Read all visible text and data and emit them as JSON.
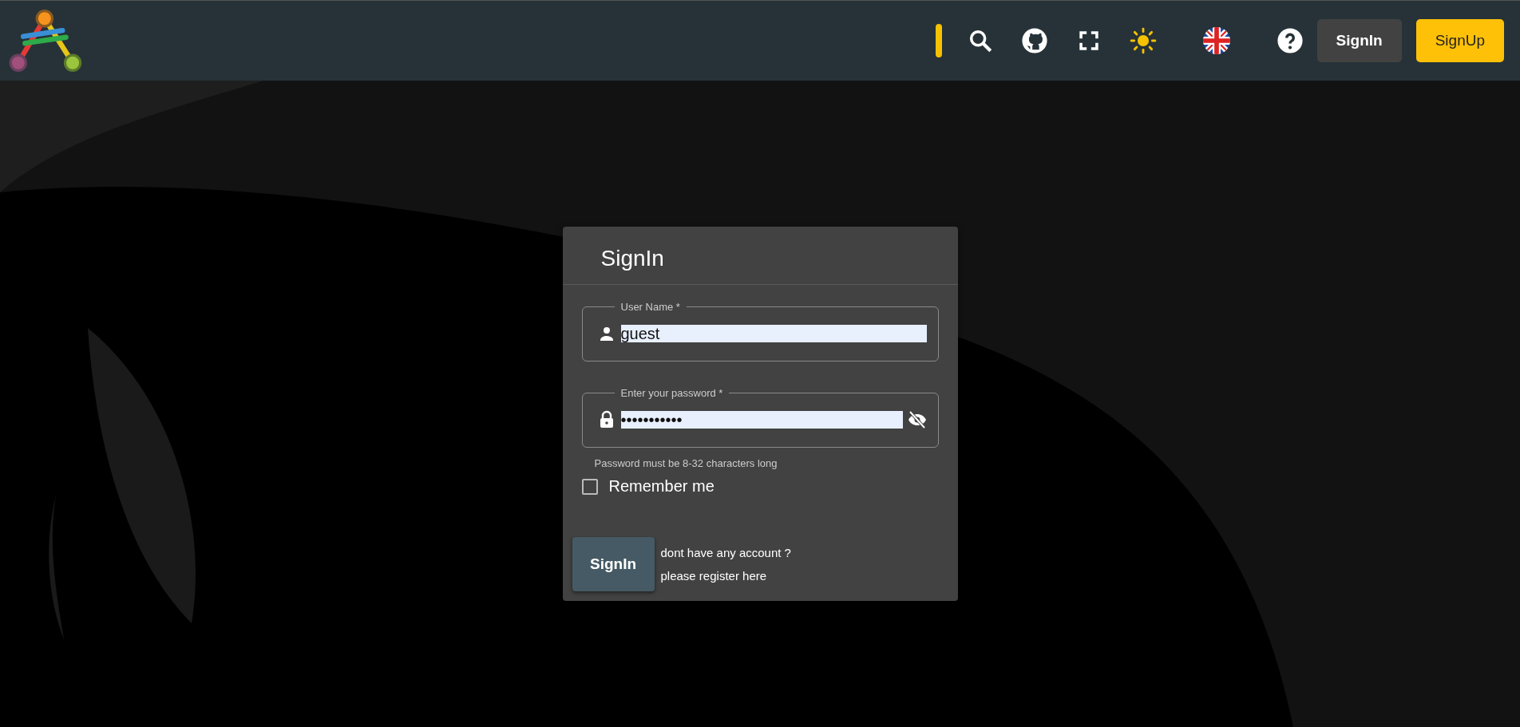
{
  "header": {
    "buttons": [
      {
        "label": "SignIn",
        "kind": "secondary"
      },
      {
        "label": "SignUp",
        "kind": "primary"
      }
    ]
  },
  "signin": {
    "title": "SignIn",
    "username": {
      "label": "User Name *",
      "value": "guest"
    },
    "password": {
      "label": "Enter your password *",
      "value": "•••••••••••",
      "visible": false,
      "hint": "Password must be 8-32 characters long"
    },
    "remember": {
      "label": "Remember me",
      "checked": false
    },
    "submit": "SignIn",
    "register_lines": [
      "dont have any account ?",
      "please register here"
    ]
  }
}
